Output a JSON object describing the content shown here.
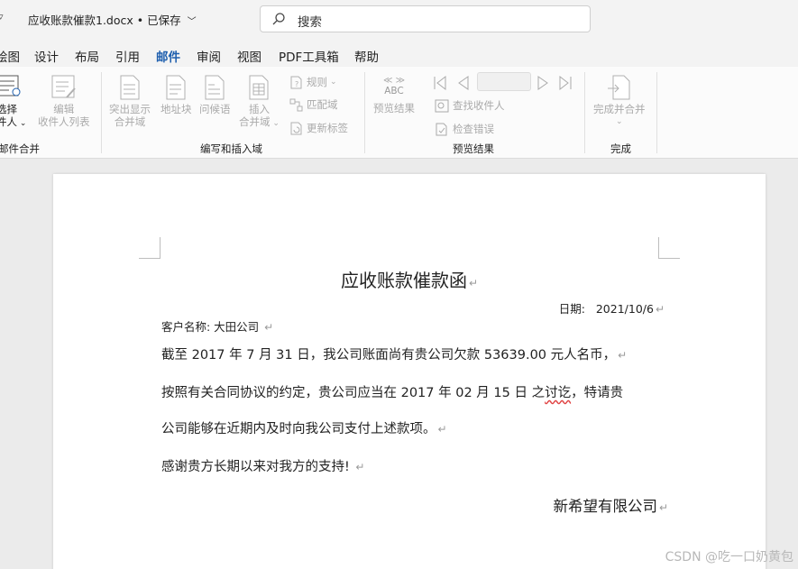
{
  "window": {
    "doc_name": "应收账款催款1.docx",
    "save_status": "• 已保存",
    "search_placeholder": "搜索"
  },
  "tabs": [
    "绘图",
    "设计",
    "布局",
    "引用",
    "邮件",
    "审阅",
    "视图",
    "PDF工具箱",
    "帮助"
  ],
  "active_tab": "邮件",
  "ribbon": {
    "start_group": {
      "select_line1": "选择",
      "select_line2": "件人",
      "edit_line1": "编辑",
      "edit_line2": "收件人列表",
      "label": "邮件合并"
    },
    "write_group": {
      "highlight_line1": "突出显示",
      "highlight_line2": "合并域",
      "address_block": "地址块",
      "greeting": "问候语",
      "insert_line1": "插入",
      "insert_line2": "合并域",
      "rules": "规则",
      "match_fields": "匹配域",
      "update_labels": "更新标签",
      "label": "编写和插入域"
    },
    "preview_group": {
      "abc_top": "≪ ≫",
      "abc_mid": "ABC",
      "preview_results": "预览结果",
      "find_recipient": "查找收件人",
      "check_errors": "检查错误",
      "label": "预览结果"
    },
    "finish_group": {
      "finish_merge": "完成并合并",
      "label": "完成"
    }
  },
  "document": {
    "heading": "应收账款催款函",
    "date_label": "日期:",
    "date_value": "2021/10/6",
    "customer": "客户名称: 大田公司",
    "line1": "截至 2017 年 7 月 31 日，我公司账面尚有贵公司欠款 53639.00  元人名币，",
    "line2_a": "按照有关合同协议的约定，贵公司应当在 2017 年 02 月 15 日  之",
    "line2_b": "讨讫",
    "line2_c": "，特请贵",
    "line3": "公司能够在近期内及时向我公司支付上述款项。",
    "line4": "感谢贵方长期以来对我方的支持!",
    "signature": "新希望有限公司",
    "para_mark": "↵"
  },
  "watermark": "CSDN @吃一口奶黄包"
}
